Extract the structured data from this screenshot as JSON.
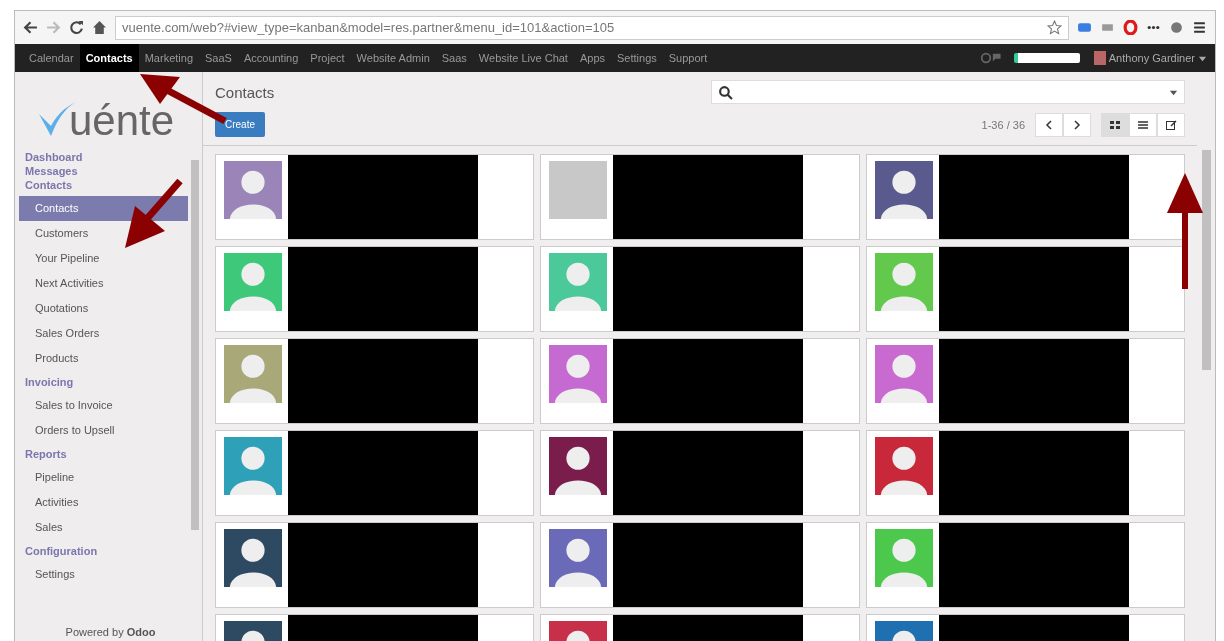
{
  "browser": {
    "url": "vuente.com/web?#view_type=kanban&model=res.partner&menu_id=101&action=105"
  },
  "topbar": {
    "menu": [
      {
        "label": "Calendar",
        "selected": false
      },
      {
        "label": "Contacts",
        "selected": true
      },
      {
        "label": "Marketing",
        "selected": false
      },
      {
        "label": "SaaS",
        "selected": false
      },
      {
        "label": "Accounting",
        "selected": false
      },
      {
        "label": "Project",
        "selected": false
      },
      {
        "label": "Website Admin",
        "selected": false
      },
      {
        "label": "Saas",
        "selected": false
      },
      {
        "label": "Website Live Chat",
        "selected": false
      },
      {
        "label": "Apps",
        "selected": false
      },
      {
        "label": "Settings",
        "selected": false
      },
      {
        "label": "Support",
        "selected": false
      }
    ],
    "user": "Anthony Gardiner"
  },
  "sidebar": {
    "logo": "uénte",
    "sections": [
      {
        "label": "Dashboard"
      },
      {
        "label": "Messages"
      },
      {
        "label": "Contacts",
        "items": [
          {
            "label": "Contacts",
            "selected": true
          },
          {
            "label": "Customers",
            "selected": false
          },
          {
            "label": "Your Pipeline",
            "selected": false
          },
          {
            "label": "Next Activities",
            "selected": false
          },
          {
            "label": "Quotations",
            "selected": false
          },
          {
            "label": "Sales Orders",
            "selected": false
          },
          {
            "label": "Products",
            "selected": false
          }
        ]
      },
      {
        "label": "Invoicing",
        "items": [
          {
            "label": "Sales to Invoice",
            "selected": false
          },
          {
            "label": "Orders to Upsell",
            "selected": false
          }
        ]
      },
      {
        "label": "Reports",
        "items": [
          {
            "label": "Pipeline",
            "selected": false
          },
          {
            "label": "Activities",
            "selected": false
          },
          {
            "label": "Sales",
            "selected": false
          }
        ]
      },
      {
        "label": "Configuration",
        "items": [
          {
            "label": "Settings",
            "selected": false
          }
        ]
      }
    ],
    "footer": "Powered by **Odoo**"
  },
  "main": {
    "title": "Contacts",
    "create": "Create",
    "pager": "1-36 / 36",
    "views": [
      {
        "kind": "kanban",
        "selected": true
      },
      {
        "kind": "list",
        "selected": false
      },
      {
        "kind": "form",
        "selected": false
      }
    ],
    "cards": [
      {
        "kind": "avatar",
        "color": "#9b84b8"
      },
      {
        "kind": "photo",
        "color": "#c8c8c8"
      },
      {
        "kind": "avatar",
        "color": "#5a5a8f"
      },
      {
        "kind": "avatar",
        "color": "#3ec97a"
      },
      {
        "kind": "avatar",
        "color": "#4cc99a"
      },
      {
        "kind": "avatar",
        "color": "#62c94c"
      },
      {
        "kind": "avatar",
        "color": "#a9a878"
      },
      {
        "kind": "avatar",
        "color": "#c56ad0"
      },
      {
        "kind": "avatar",
        "color": "#c86ad0"
      },
      {
        "kind": "avatar",
        "color": "#2ea0b8"
      },
      {
        "kind": "avatar",
        "color": "#7a1c4c"
      },
      {
        "kind": "avatar",
        "color": "#c8283a"
      },
      {
        "kind": "avatar",
        "color": "#2e4a63"
      },
      {
        "kind": "avatar",
        "color": "#6a6ab8"
      },
      {
        "kind": "avatar",
        "color": "#4cc94c"
      },
      {
        "kind": "avatar",
        "color": "#2e4a63"
      },
      {
        "kind": "avatar",
        "color": "#c8304a"
      },
      {
        "kind": "avatar",
        "color": "#1f70b0"
      }
    ]
  }
}
